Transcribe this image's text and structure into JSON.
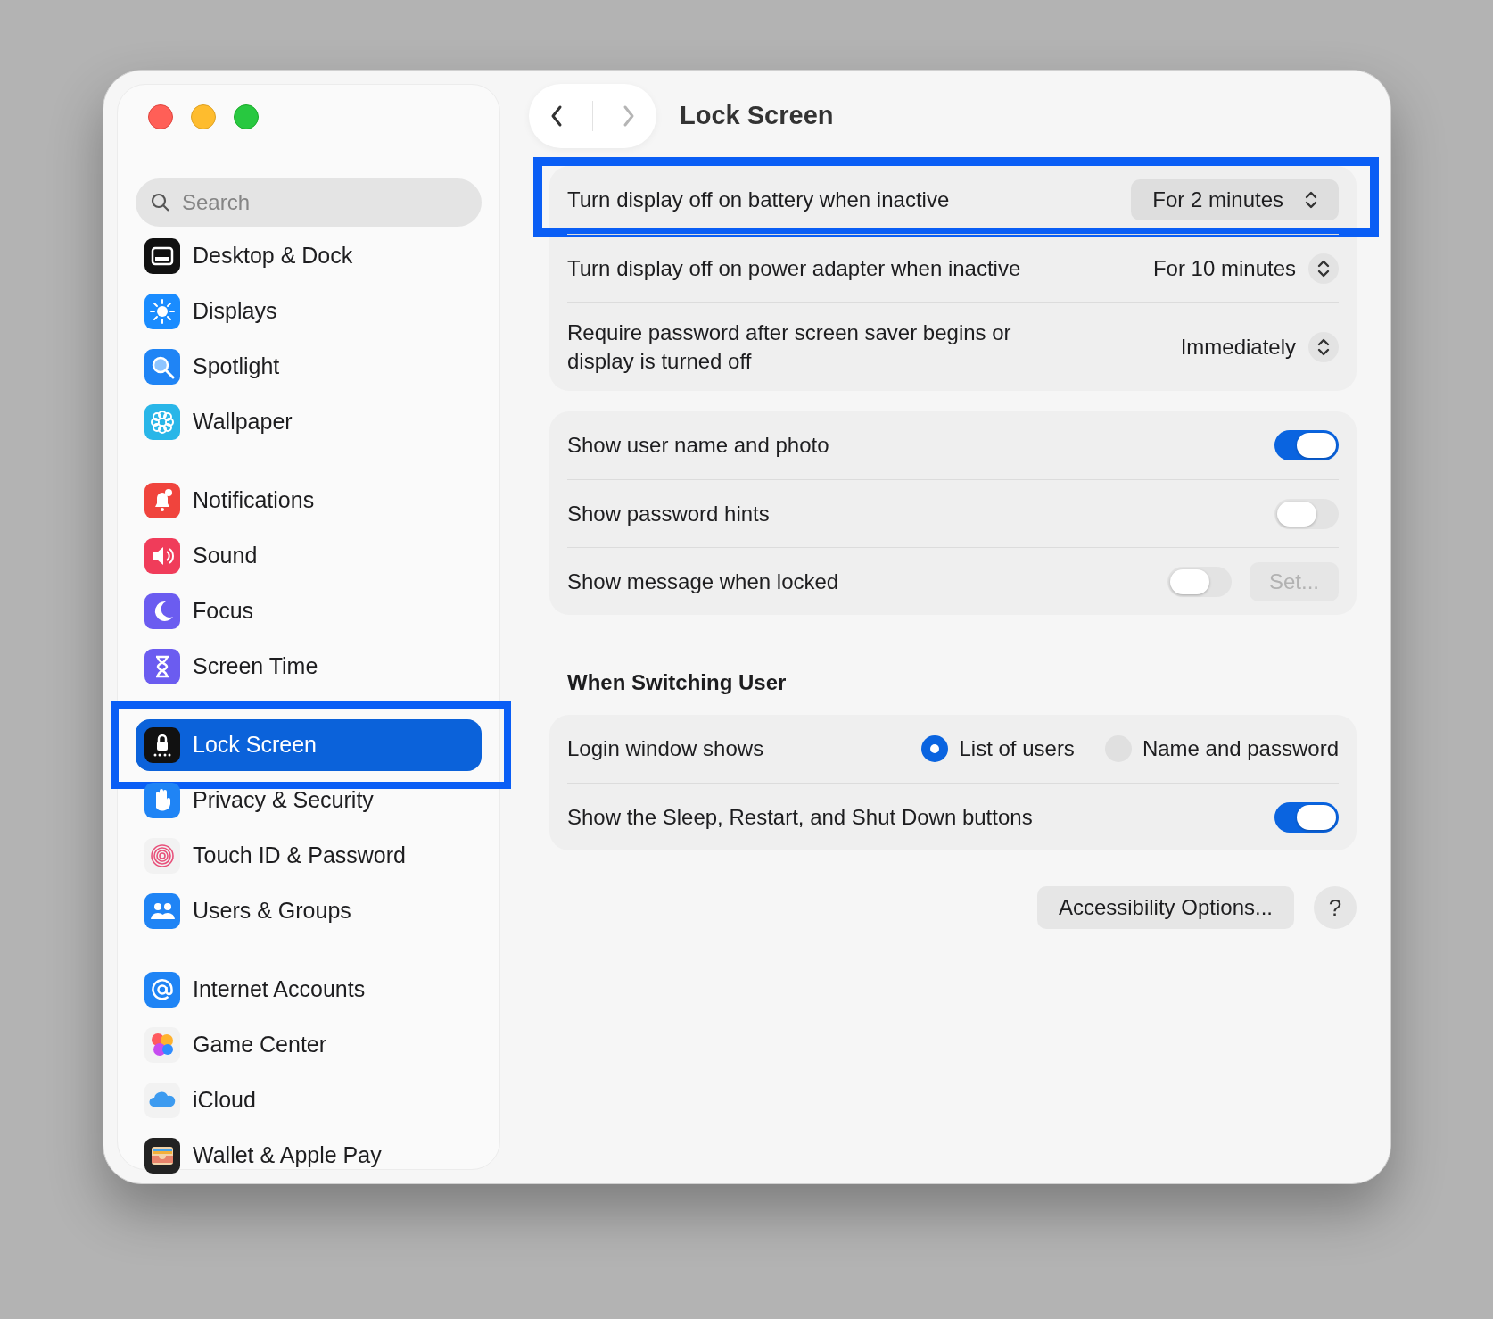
{
  "navigation": [
    {
      "kind": "back",
      "disabled": false
    },
    {
      "kind": "forward",
      "disabled": true
    }
  ],
  "title": "Lock Screen",
  "sidebar": {
    "search": {
      "placeholder": "Search"
    },
    "groups": [
      {
        "items": [
          {
            "label": "Desktop & Dock",
            "selected": false,
            "highlighted": false
          },
          {
            "label": "Displays",
            "selected": false,
            "highlighted": false
          },
          {
            "label": "Spotlight",
            "selected": false,
            "highlighted": false
          },
          {
            "label": "Wallpaper",
            "selected": false,
            "highlighted": false
          }
        ]
      },
      {
        "items": [
          {
            "label": "Notifications",
            "selected": false,
            "highlighted": false
          },
          {
            "label": "Sound",
            "selected": false,
            "highlighted": false
          },
          {
            "label": "Focus",
            "selected": false,
            "highlighted": false
          },
          {
            "label": "Screen Time",
            "selected": false,
            "highlighted": false
          }
        ]
      },
      {
        "items": [
          {
            "label": "Lock Screen",
            "selected": true,
            "highlighted": true
          },
          {
            "label": "Privacy & Security",
            "selected": false,
            "highlighted": false
          },
          {
            "label": "Touch ID & Password",
            "selected": false,
            "highlighted": false
          },
          {
            "label": "Users & Groups",
            "selected": false,
            "highlighted": false
          }
        ]
      },
      {
        "items": [
          {
            "label": "Internet Accounts",
            "selected": false,
            "highlighted": false
          },
          {
            "label": "Game Center",
            "selected": false,
            "highlighted": false
          },
          {
            "label": "iCloud",
            "selected": false,
            "highlighted": false
          },
          {
            "label": "Wallet & Apple Pay",
            "selected": false,
            "highlighted": false
          }
        ]
      }
    ]
  },
  "sections": [
    {
      "rows": [
        {
          "kind": "popup",
          "label": "Turn display off on battery when inactive",
          "value": "For 2 minutes",
          "focused": true,
          "highlighted": true
        },
        {
          "kind": "popup",
          "label": "Turn display off on power adapter when inactive",
          "value": "For 10 minutes",
          "focused": false,
          "highlighted": false
        },
        {
          "kind": "popup",
          "label": "Require password after screen saver begins or display is turned off",
          "value": "Immediately",
          "focused": false,
          "highlighted": false
        }
      ]
    },
    {
      "rows": [
        {
          "kind": "toggle",
          "label": "Show user name and photo",
          "on": true
        },
        {
          "kind": "toggle",
          "label": "Show password hints",
          "on": false
        },
        {
          "kind": "toggle",
          "label": "Show message when locked",
          "on": false,
          "button": {
            "label": "Set...",
            "disabled": true
          }
        }
      ]
    },
    {
      "heading": "When Switching User",
      "rows": [
        {
          "kind": "radio",
          "label": "Login window shows",
          "options": [
            {
              "label": "List of users",
              "selected": true
            },
            {
              "label": "Name and password",
              "selected": false
            }
          ]
        },
        {
          "kind": "toggle",
          "label": "Show the Sleep, Restart, and Shut Down buttons",
          "on": true
        }
      ]
    }
  ],
  "footer": [
    {
      "kind": "button",
      "label": "Accessibility Options..."
    },
    {
      "kind": "help",
      "label": "?"
    }
  ]
}
